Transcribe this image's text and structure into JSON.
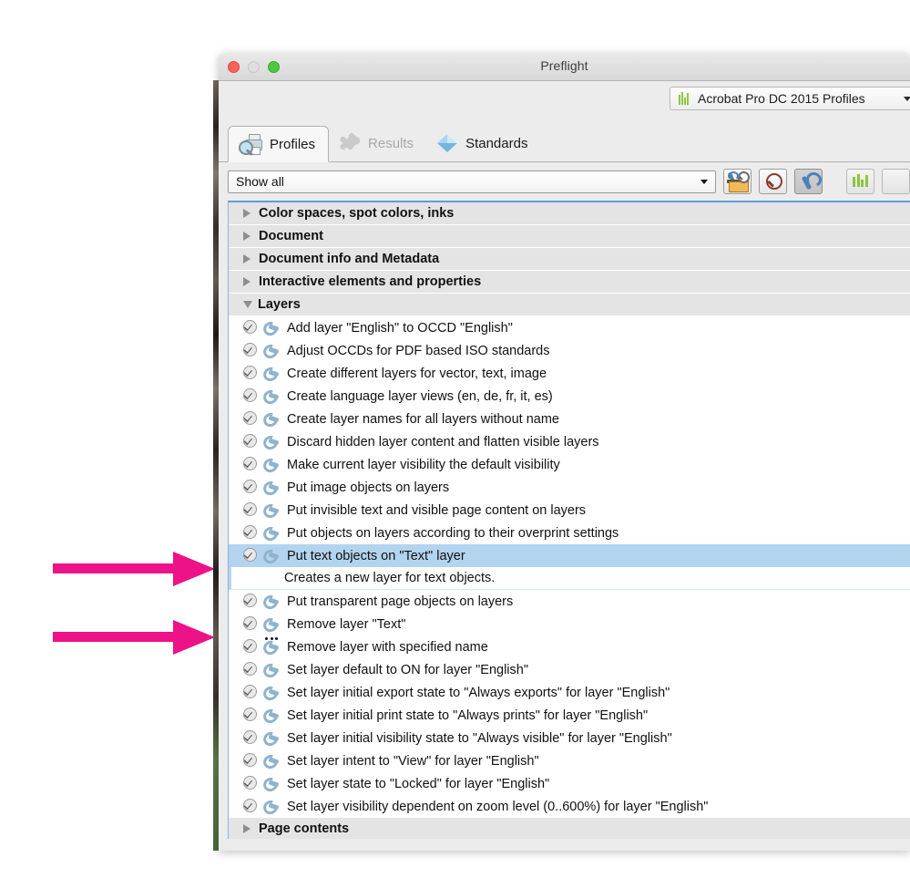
{
  "window": {
    "title": "Preflight",
    "traffic_lights": [
      "close",
      "minimize",
      "zoom"
    ]
  },
  "profile_set": {
    "icon": "green-bars-icon",
    "label": "Acrobat Pro DC 2015 Profiles",
    "caret": "chevron-down-icon"
  },
  "tabs": [
    {
      "id": "profiles",
      "label": "Profiles",
      "icon": "printer-magnifier-icon",
      "state": "active"
    },
    {
      "id": "results",
      "label": "Results",
      "icon": "check-cross-icon",
      "state": "disabled"
    },
    {
      "id": "standards",
      "label": "Standards",
      "icon": "blue-diamond-icon",
      "state": "normal"
    }
  ],
  "filter": {
    "value": "Show all",
    "placeholder": "Show all",
    "caret": "chevron-down-icon"
  },
  "toolbar": [
    {
      "id": "edit-profile",
      "icon": "toolbox-icon",
      "pressed": false
    },
    {
      "id": "find-profile",
      "icon": "magnifier-icon",
      "pressed": false
    },
    {
      "id": "create-fixup",
      "icon": "blue-wrench-icon",
      "pressed": true
    },
    {
      "id": "profile-set",
      "icon": "green-bars-icon",
      "pressed": false
    }
  ],
  "tree": [
    {
      "kind": "group",
      "state": "collapsed",
      "label": "Color spaces, spot colors, inks"
    },
    {
      "kind": "group",
      "state": "collapsed",
      "label": "Document"
    },
    {
      "kind": "group",
      "state": "collapsed",
      "label": "Document info and Metadata"
    },
    {
      "kind": "group",
      "state": "collapsed",
      "label": "Interactive elements and properties"
    },
    {
      "kind": "group",
      "state": "expanded",
      "label": "Layers"
    },
    {
      "kind": "item",
      "icon": "wrench-icon",
      "label": "Add layer \"English\" to OCCD \"English\""
    },
    {
      "kind": "item",
      "icon": "wrench-icon",
      "label": "Adjust OCCDs for PDF based ISO standards"
    },
    {
      "kind": "item",
      "icon": "wrench-icon",
      "label": "Create different layers for vector, text, image"
    },
    {
      "kind": "item",
      "icon": "wrench-icon",
      "label": "Create language layer views (en, de, fr, it, es)"
    },
    {
      "kind": "item",
      "icon": "wrench-icon",
      "label": "Create layer names for all layers without name"
    },
    {
      "kind": "item",
      "icon": "wrench-icon",
      "label": "Discard hidden layer content and flatten visible layers"
    },
    {
      "kind": "item",
      "icon": "wrench-icon",
      "label": "Make current layer visibility the default visibility"
    },
    {
      "kind": "item",
      "icon": "wrench-icon",
      "label": "Put image objects on layers"
    },
    {
      "kind": "item",
      "icon": "wrench-icon",
      "label": "Put invisible text and visible page content on layers"
    },
    {
      "kind": "item",
      "icon": "wrench-icon",
      "label": "Put objects on layers according to their overprint settings"
    },
    {
      "kind": "item",
      "icon": "wrench-icon",
      "label": "Put text objects on \"Text\" layer",
      "selected": true
    },
    {
      "kind": "desc",
      "label": "Creates a new layer for text objects."
    },
    {
      "kind": "item",
      "icon": "wrench-icon",
      "label": "Put transparent page objects on layers"
    },
    {
      "kind": "item",
      "icon": "wrench-icon",
      "label": "Remove layer \"Text\""
    },
    {
      "kind": "item",
      "icon": "wrench-dots-icon",
      "label": "Remove layer with specified name"
    },
    {
      "kind": "item",
      "icon": "wrench-icon",
      "label": "Set layer default to ON for layer \"English\""
    },
    {
      "kind": "item",
      "icon": "wrench-icon",
      "label": "Set layer initial export state to \"Always exports\" for layer \"English\""
    },
    {
      "kind": "item",
      "icon": "wrench-icon",
      "label": "Set layer initial print state to \"Always prints\" for layer \"English\""
    },
    {
      "kind": "item",
      "icon": "wrench-icon",
      "label": "Set layer initial visibility state to \"Always visible\" for layer \"English\""
    },
    {
      "kind": "item",
      "icon": "wrench-icon",
      "label": "Set layer intent to \"View\" for layer \"English\""
    },
    {
      "kind": "item",
      "icon": "wrench-icon",
      "label": "Set layer state to \"Locked\" for layer \"English\""
    },
    {
      "kind": "item",
      "icon": "wrench-icon",
      "label": "Set layer visibility dependent on zoom level (0..600%) for layer \"English\""
    },
    {
      "kind": "group",
      "state": "collapsed",
      "label": "Page contents"
    }
  ],
  "annotations": {
    "color": "#ee1289",
    "arrows": [
      {
        "id": "arrow-top",
        "points_to": "Put text objects on \"Text\" layer"
      },
      {
        "id": "arrow-bottom",
        "points_to": "Remove layer \"Text\""
      }
    ]
  }
}
